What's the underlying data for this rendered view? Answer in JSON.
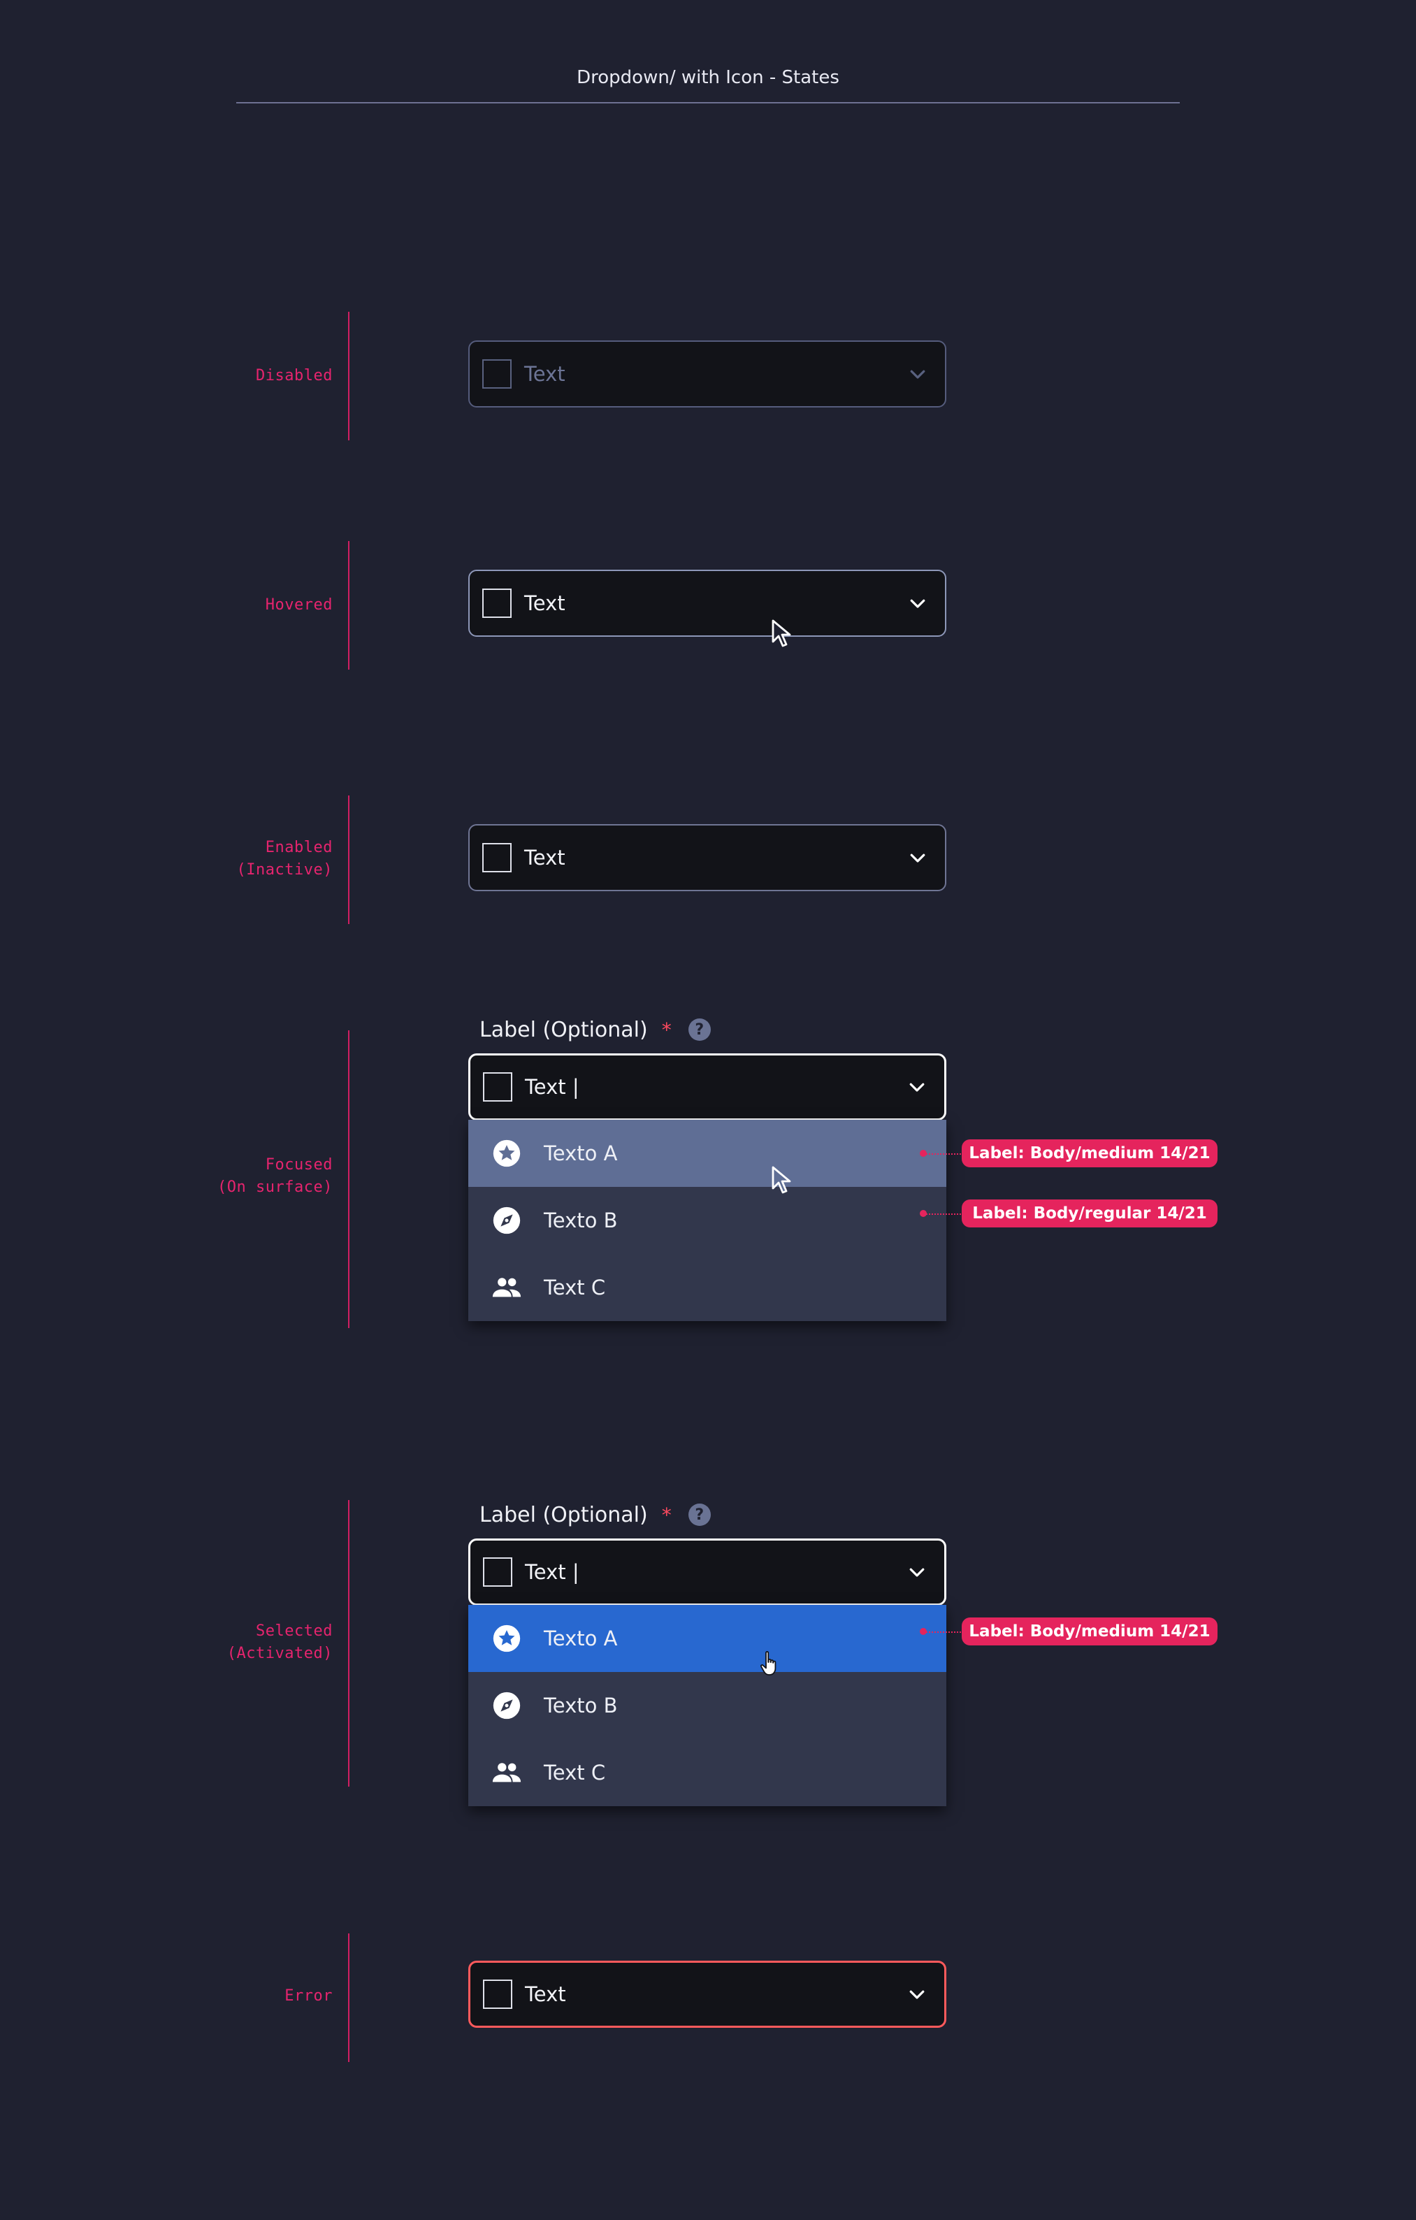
{
  "header": {
    "title": "Dropdown/  with Icon - States"
  },
  "states": {
    "disabled": {
      "label": "Disabled",
      "value": "Text"
    },
    "hovered": {
      "label": "Hovered",
      "value": "Text"
    },
    "enabled": {
      "label": "Enabled\n(Inactive)",
      "value": "Text"
    },
    "focused": {
      "label": "Focused\n(On surface)",
      "field_label": "Label (Optional)",
      "required_mark": "*",
      "help_glyph": "?",
      "value": "Text |",
      "options": [
        {
          "label": "Texto A",
          "icon": "star-circle-icon",
          "state": "hover"
        },
        {
          "label": "Texto B",
          "icon": "compass-icon",
          "state": "default"
        },
        {
          "label": "Text C",
          "icon": "people-icon",
          "state": "default"
        }
      ],
      "annotations": [
        "Label: Body/medium 14/21",
        "Label: Body/regular 14/21"
      ]
    },
    "selected": {
      "label": "Selected\n(Activated)",
      "field_label": "Label (Optional)",
      "required_mark": "*",
      "help_glyph": "?",
      "value": "Text |",
      "options": [
        {
          "label": "Texto A",
          "icon": "star-circle-icon",
          "state": "active"
        },
        {
          "label": "Texto B",
          "icon": "compass-icon",
          "state": "default"
        },
        {
          "label": "Text C",
          "icon": "people-icon",
          "state": "default"
        }
      ],
      "annotations": [
        "Label: Body/medium 14/21"
      ]
    },
    "error": {
      "label": "Error",
      "value": "Text"
    }
  },
  "colors": {
    "background": "#1f2130",
    "state_label": "#e6246e",
    "field_bg": "#121318",
    "menu_bg": "#32374c",
    "option_hover": "#5f6e95",
    "option_active": "#2868d0",
    "error_border": "#ff5a5c",
    "annotation": "#e5245d"
  }
}
